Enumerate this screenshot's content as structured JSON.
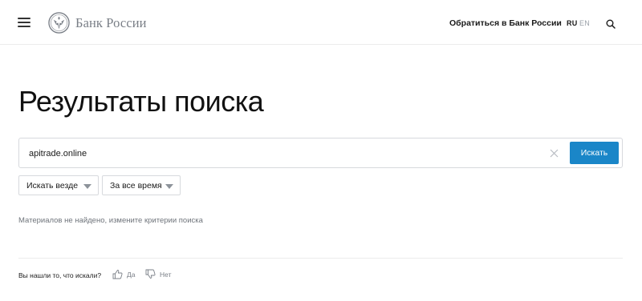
{
  "header": {
    "logo_text": "Банк России",
    "contact_link": "Обратиться в Банк России",
    "lang_ru": "RU",
    "lang_en": "EN"
  },
  "page_title": "Результаты поиска",
  "search": {
    "value": "apitrade.online",
    "submit_label": "Искать"
  },
  "filters": {
    "where_label": "Искать везде",
    "when_label": "За все время"
  },
  "no_results_text": "Материалов не найдено, измените критерии поиска",
  "feedback": {
    "question": "Вы нашли то, что искали?",
    "yes_label": "Да",
    "no_label": "Нет"
  },
  "colors": {
    "accent": "#1a86c8",
    "muted_text": "#6f747b",
    "border": "#d7d9dd"
  },
  "icons": [
    "menu-icon",
    "bank-emblem-icon",
    "search-icon",
    "close-icon",
    "chevron-down-icon",
    "thumbs-up-icon",
    "thumbs-down-icon"
  ]
}
